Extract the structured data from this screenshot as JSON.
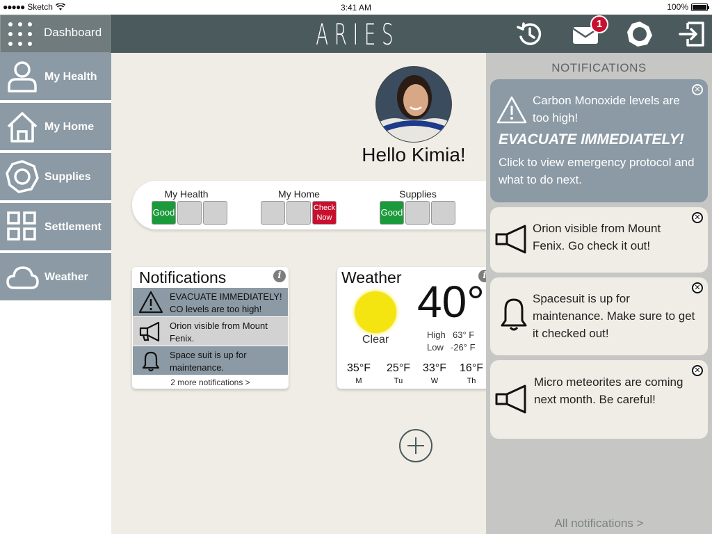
{
  "status_bar": {
    "carrier": "Sketch",
    "time": "3:41 AM",
    "battery": "100%"
  },
  "header": {
    "dashboard_label": "Dashboard",
    "logo": "ARIES",
    "mail_badge": "1",
    "icons": [
      "history-icon",
      "mail-icon",
      "settings-icon",
      "logout-icon"
    ]
  },
  "sidebar": {
    "items": [
      {
        "label": "My Health",
        "icon": "person-icon"
      },
      {
        "label": "My Home",
        "icon": "home-icon"
      },
      {
        "label": "Supplies",
        "icon": "supplies-icon"
      },
      {
        "label": "Settlement",
        "icon": "grid-icon"
      },
      {
        "label": "Weather",
        "icon": "cloud-icon"
      }
    ]
  },
  "main": {
    "greeting": "Hello Kimia!",
    "status_groups": [
      {
        "label": "My Health",
        "status": "Good"
      },
      {
        "label": "My Home",
        "status": "Check Now"
      },
      {
        "label": "Supplies",
        "status": "Good"
      }
    ],
    "notifications_card": {
      "title": "Notifications",
      "items": [
        {
          "text": "EVACUATE IMMEDIATELY! CO levels are too high!",
          "icon": "warning-icon"
        },
        {
          "text": "Orion visible from Mount Fenix.",
          "icon": "megaphone-icon"
        },
        {
          "text": "Space suit is up for maintenance.",
          "icon": "bell-icon"
        }
      ],
      "more": "2 more notifications >"
    },
    "weather_card": {
      "title": "Weather",
      "condition": "Clear",
      "temp": "40°",
      "high_label": "High",
      "high": "63° F",
      "low_label": "Low",
      "low": "-26° F",
      "forecast": [
        {
          "temp": "35°F",
          "day": "M"
        },
        {
          "temp": "25°F",
          "day": "Tu"
        },
        {
          "temp": "33°F",
          "day": "W"
        },
        {
          "temp": "16°F",
          "day": "Th"
        }
      ]
    }
  },
  "drawer": {
    "title": "NOTIFICATIONS",
    "cards": [
      {
        "line1": "Carbon Monoxide levels are too high!",
        "headline": "EVACUATE IMMEDIATELY!",
        "line2": "Click to view emergency protocol and what to do next.",
        "icon": "warning-icon"
      },
      {
        "text": "Orion visible from Mount Fenix. Go check it out!",
        "icon": "megaphone-icon"
      },
      {
        "text": "Spacesuit is up for maintenance. Make sure to get it checked out!",
        "icon": "bell-icon"
      },
      {
        "text": "Micro meteorites are coming next month. Be careful!",
        "icon": "megaphone-icon"
      }
    ],
    "all_link": "All notifications >"
  },
  "colors": {
    "header": "#4b5b5d",
    "sidebar_tile": "#8b9aa5",
    "good": "#1a9a3a",
    "alert": "#c8102e",
    "drawer": "#c6c7c4",
    "background": "#f0ede6"
  }
}
